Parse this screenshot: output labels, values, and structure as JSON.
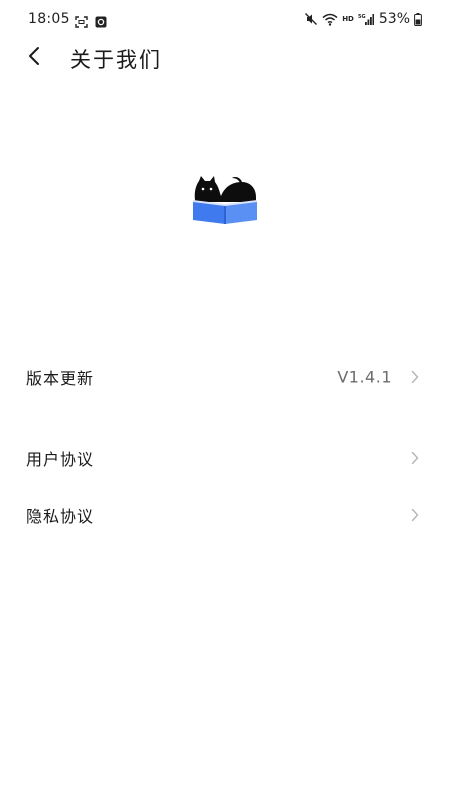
{
  "status_bar": {
    "time": "18:05",
    "network_label": "HD",
    "battery_percent": "53%",
    "icons": [
      "screenshot-icon",
      "notification-app-icon",
      "mute-icon",
      "wifi-icon",
      "signal-icon",
      "battery-icon"
    ]
  },
  "header": {
    "title": "关于我们",
    "back_icon": "chevron-left-icon"
  },
  "logo": {
    "icon": "cat-on-book-logo",
    "colors": {
      "cat": "#0d0d0d",
      "book_left": "#3f7bef",
      "book_right": "#3f7bef",
      "book_pages": "#d9e4fb"
    }
  },
  "settings": {
    "items": [
      {
        "label": "版本更新",
        "value": "V1.4.1"
      },
      {
        "label": "用户协议",
        "value": ""
      },
      {
        "label": "隐私协议",
        "value": ""
      }
    ]
  },
  "colors": {
    "background": "#ffffff",
    "text_primary": "#1a1a1a",
    "text_secondary": "#6b6b6b",
    "chevron": "#b5b5b5"
  }
}
